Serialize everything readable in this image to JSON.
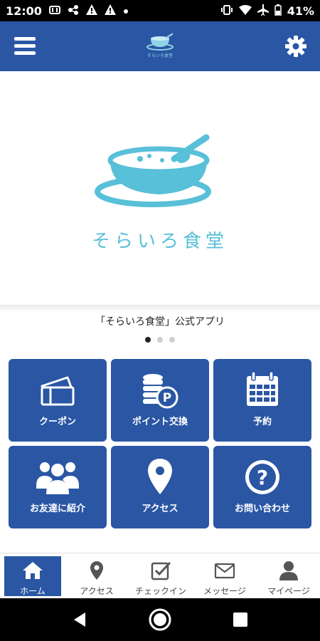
{
  "status_bar": {
    "time": "12:00",
    "battery": "41%",
    "icons_left": [
      "nfc-icon",
      "share-icon",
      "warning-icon",
      "warning-icon",
      "dot-icon"
    ],
    "icons_right": [
      "vibrate-icon",
      "wifi-icon",
      "airplane-icon",
      "battery-icon"
    ]
  },
  "header": {
    "logo_text": "そらいろ食堂",
    "menu_icon": "hamburger-menu-icon",
    "settings_icon": "gear-icon"
  },
  "hero": {
    "brand": "そらいろ食堂",
    "caption": "「そらいろ食堂」公式アプリ",
    "carousel_count": 3,
    "carousel_active": 0
  },
  "tiles": [
    {
      "label": "クーポン",
      "icon": "ticket-icon"
    },
    {
      "label": "ポイント交換",
      "icon": "coins-icon"
    },
    {
      "label": "予約",
      "icon": "calendar-icon"
    },
    {
      "label": "お友達に紹介",
      "icon": "group-icon"
    },
    {
      "label": "アクセス",
      "icon": "map-pin-icon"
    },
    {
      "label": "お問い合わせ",
      "icon": "question-icon"
    }
  ],
  "bottom_nav": [
    {
      "label": "ホーム",
      "icon": "home-icon",
      "active": true
    },
    {
      "label": "アクセス",
      "icon": "map-pin-icon",
      "active": false
    },
    {
      "label": "チェックイン",
      "icon": "checkin-icon",
      "active": false
    },
    {
      "label": "メッセージ",
      "icon": "mail-icon",
      "active": false
    },
    {
      "label": "マイページ",
      "icon": "user-icon",
      "active": false
    }
  ],
  "colors": {
    "primary": "#2a56a4",
    "brand_light_blue": "#58c0d8",
    "status_bar": "#000000"
  }
}
